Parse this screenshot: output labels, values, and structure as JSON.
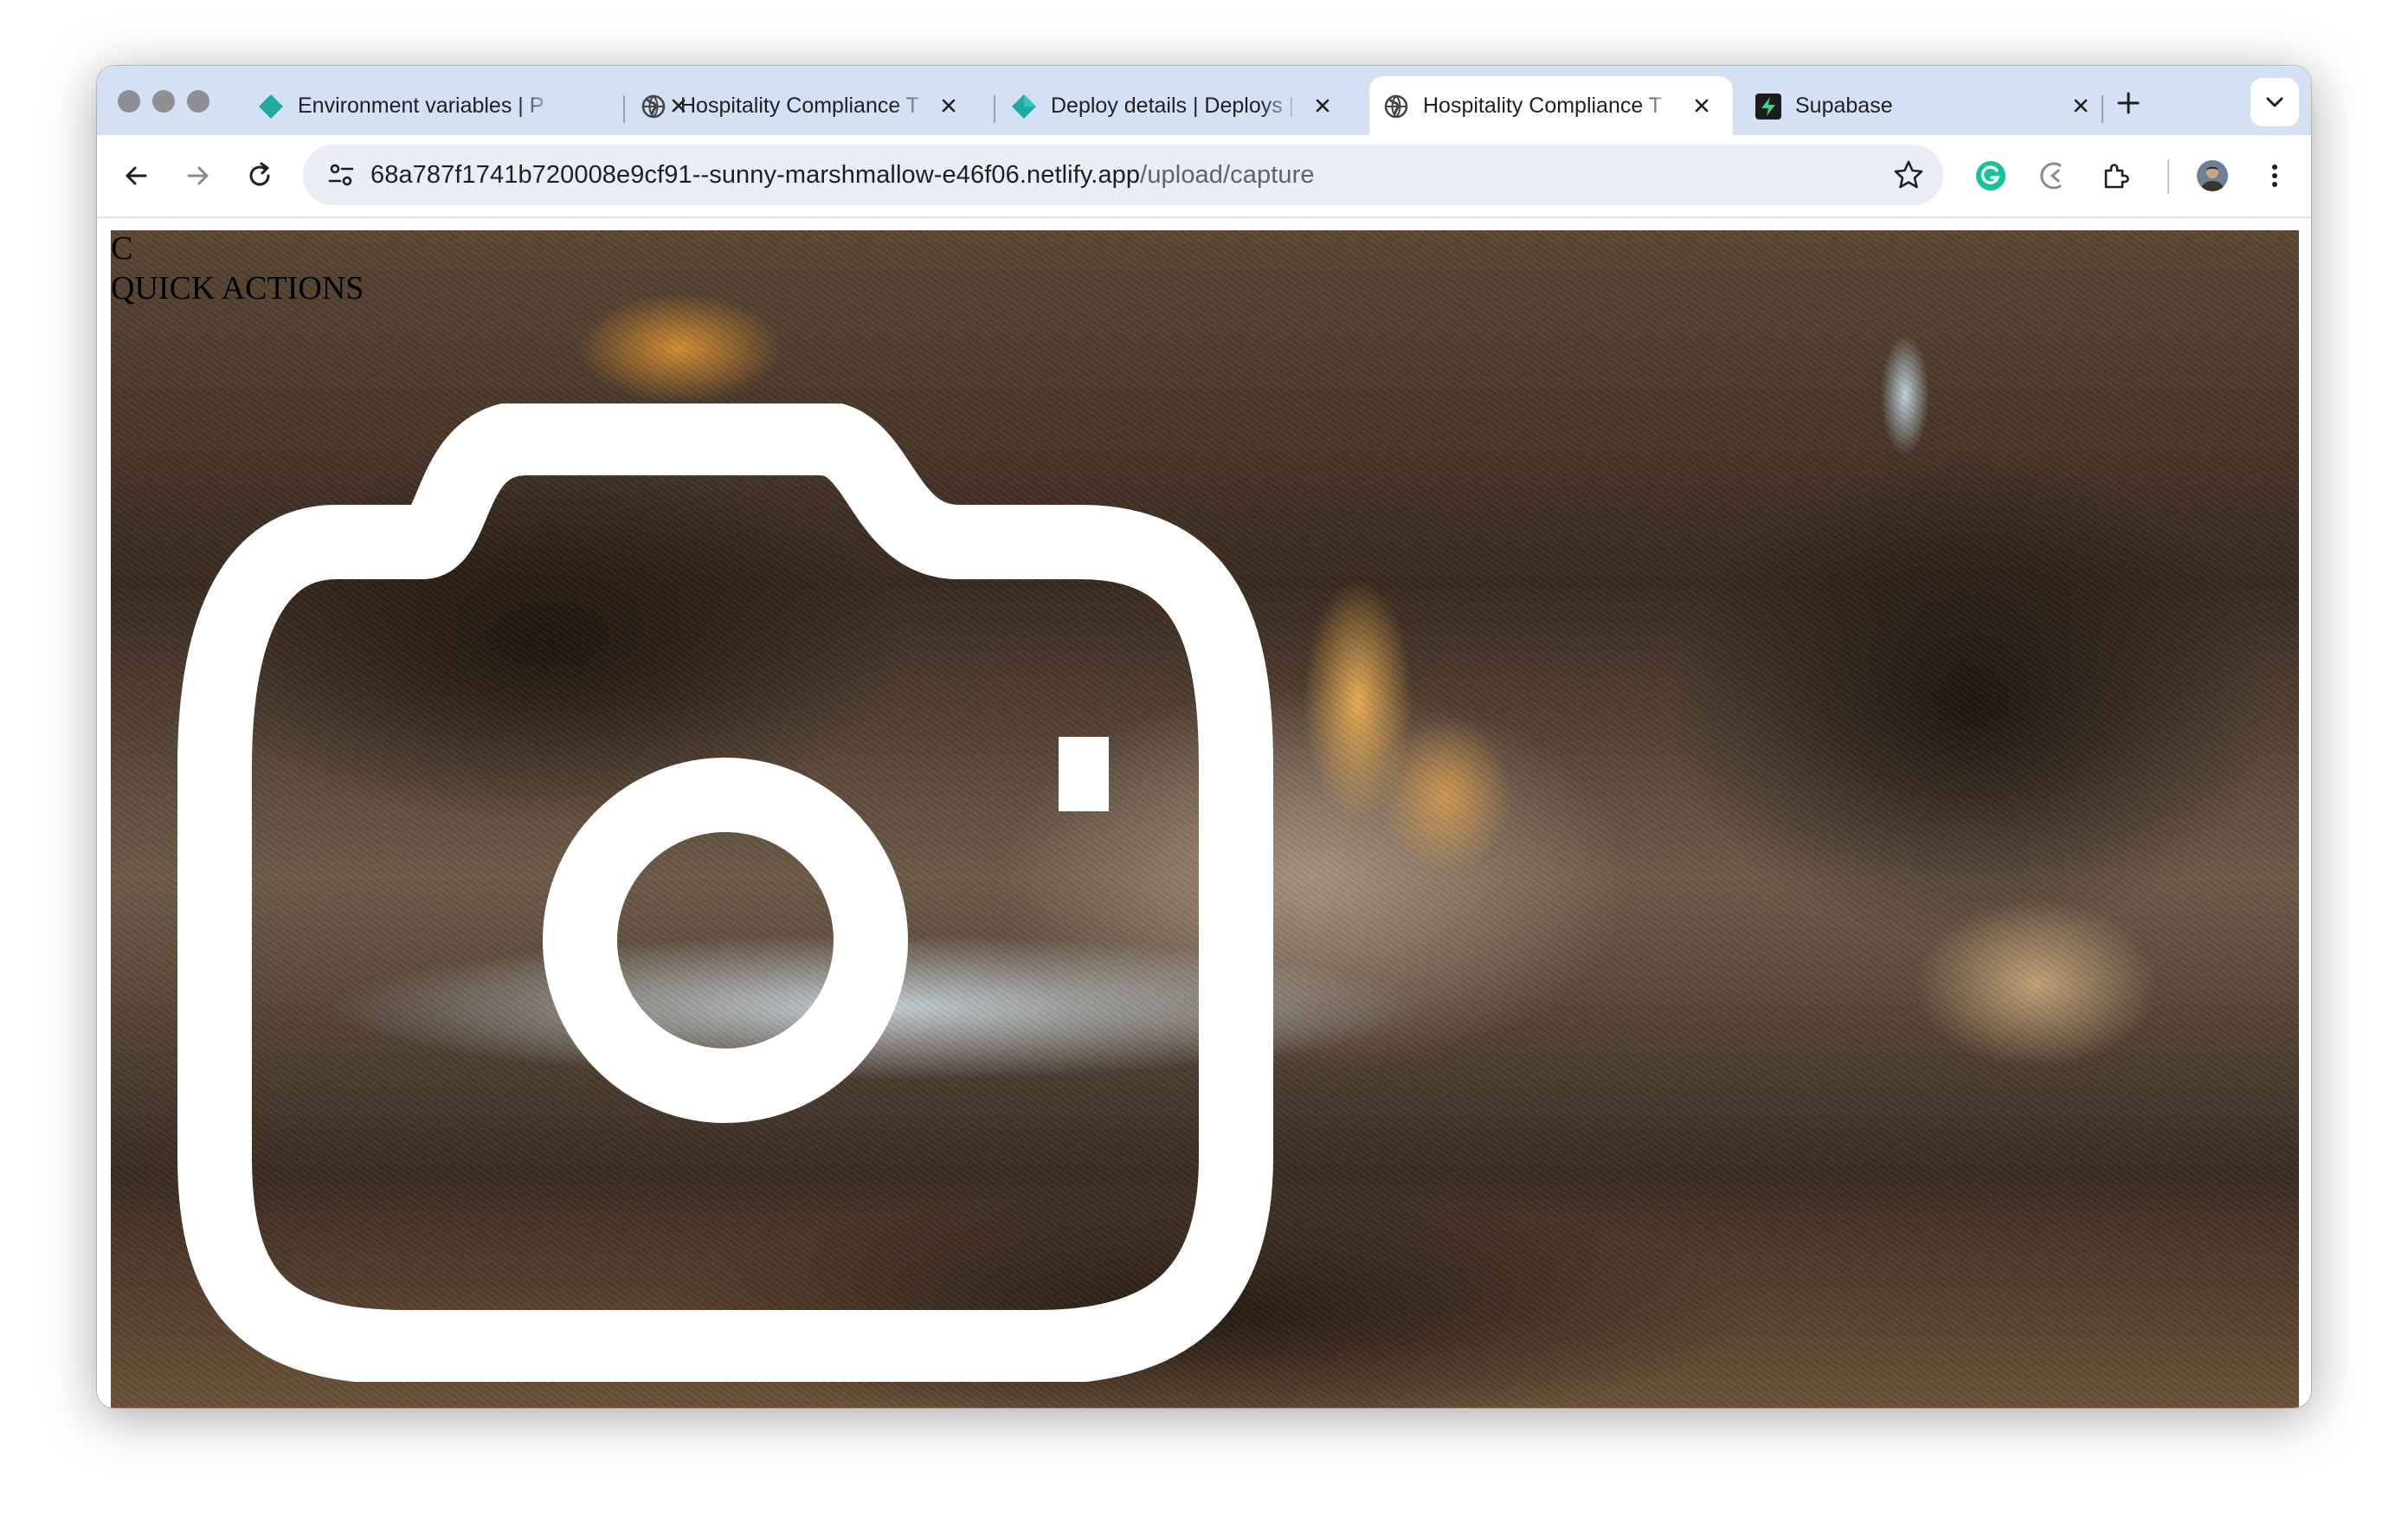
{
  "browser": {
    "tabs": [
      {
        "title": "Environment variables | P",
        "icon": "netlify-diamond-icon",
        "active": false
      },
      {
        "title": "Hospitality Compliance T",
        "icon": "globe-icon",
        "active": false
      },
      {
        "title": "Deploy details | Deploys |",
        "icon": "netlify-icon",
        "active": false
      },
      {
        "title": "Hospitality Compliance T",
        "icon": "globe-icon",
        "active": true
      },
      {
        "title": "Supabase",
        "icon": "supabase-icon",
        "active": false
      }
    ],
    "url_host": "68a787f1741b720008e9cf91--sunny-marshmallow-e46f06.netlify.app",
    "url_path": "/upload/capture"
  },
  "page": {
    "header_letter": "C",
    "quick_actions_label": "QUICK ACTIONS",
    "hero_icon": "camera-icon"
  },
  "colors": {
    "tabstrip": "#d4e1f5",
    "omnibox": "#e9eef6",
    "netlify": "#20a8a3",
    "supabase": "#3ecf8e"
  }
}
